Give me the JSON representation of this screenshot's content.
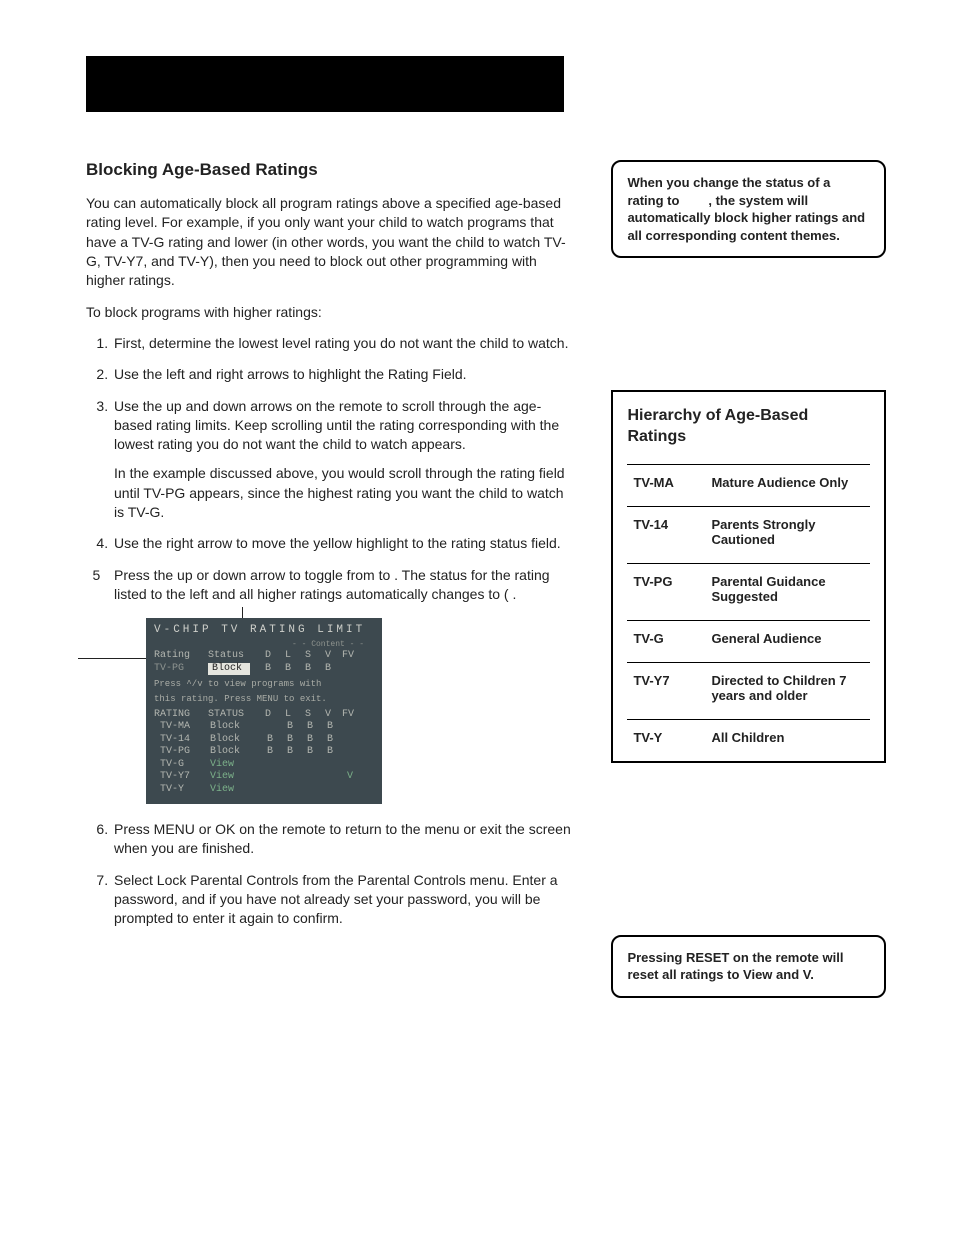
{
  "heading": "Blocking Age-Based Ratings",
  "intro": "You can automatically block all program ratings above a specified age-based rating level. For example, if you only want your child to watch programs that have a TV-G rating and lower (in other words, you want the child to watch TV-G, TV-Y7, and TV-Y), then you need to block out other programming with higher ratings.",
  "lead": "To block programs with higher ratings:",
  "steps": {
    "s1": "First, determine the lowest level rating you do not want the child to watch.",
    "s2": "Use the left and right arrows to highlight the Rating Field.",
    "s3": "Use the up and down arrows on the remote to scroll through the age-based rating limits. Keep scrolling until the rating corresponding with the lowest rating you do not want the child to watch appears.",
    "s3b": "In the example discussed above, you would scroll through the rating field until TV-PG appears, since the highest rating you want the child to watch is TV-G.",
    "s4": "Use the right arrow to move the yellow highlight to the rating status field.",
    "s5": "Press the up or down arrow to toggle from           to         . The status for the rating listed to the left and all higher ratings automatically changes to             (   .",
    "s6": "Press MENU or OK on the remote to return to the menu or exit the screen when you are finished.",
    "s7": "Select Lock Parental Controls from the Parental Controls menu. Enter a password, and if you have not already set your password, you will be prompted to enter it again to confirm."
  },
  "callout1_a": "When you change the status of a rating to",
  "callout1_b": ", the system will automatically block higher ratings and all corresponding content themes.",
  "callout2": "Pressing RESET on the remote will reset all ratings to View and V.",
  "hier": {
    "title": "Hierarchy of Age-Based Ratings",
    "rows": [
      {
        "code": "TV-MA",
        "desc": "Mature Audience Only"
      },
      {
        "code": "TV-14",
        "desc": "Parents Strongly Cautioned"
      },
      {
        "code": "TV-PG",
        "desc": "Parental Guidance Suggested"
      },
      {
        "code": "TV-G",
        "desc": "General Audience"
      },
      {
        "code": "TV-Y7",
        "desc": "Directed to Children 7 years and older"
      },
      {
        "code": "TV-Y",
        "desc": "All Children"
      }
    ]
  },
  "menu": {
    "title": "V-CHIP TV RATING LIMIT",
    "content_label": "- - Content - -",
    "hdr_rating": "Rating",
    "hdr_status": "Status",
    "cols": {
      "d": "D",
      "l": "L",
      "s": "S",
      "v": "V",
      "fv": "FV"
    },
    "sel_rating": "TV-PG",
    "sel_status": "Block",
    "sel_flags": {
      "d": "B",
      "l": "B",
      "s": "B",
      "v": "B",
      "fv": ""
    },
    "help1": "Press ^/v to view programs with",
    "help2": "this rating. Press MENU to exit.",
    "list_hdr_rating": "RATING",
    "list_hdr_status": "STATUS",
    "rows": [
      {
        "r": "TV-MA",
        "st": "Block",
        "d": "",
        "l": "B",
        "s": "B",
        "v": "B",
        "fv": ""
      },
      {
        "r": "TV-14",
        "st": "Block",
        "d": "B",
        "l": "B",
        "s": "B",
        "v": "B",
        "fv": ""
      },
      {
        "r": "TV-PG",
        "st": "Block",
        "d": "B",
        "l": "B",
        "s": "B",
        "v": "B",
        "fv": ""
      },
      {
        "r": "TV-G",
        "st": "View",
        "d": "",
        "l": "",
        "s": "",
        "v": "",
        "fv": ""
      },
      {
        "r": "TV-Y7",
        "st": "View",
        "d": "",
        "l": "",
        "s": "",
        "v": "",
        "fv": "V"
      },
      {
        "r": "TV-Y",
        "st": "View",
        "d": "",
        "l": "",
        "s": "",
        "v": "",
        "fv": ""
      }
    ]
  }
}
